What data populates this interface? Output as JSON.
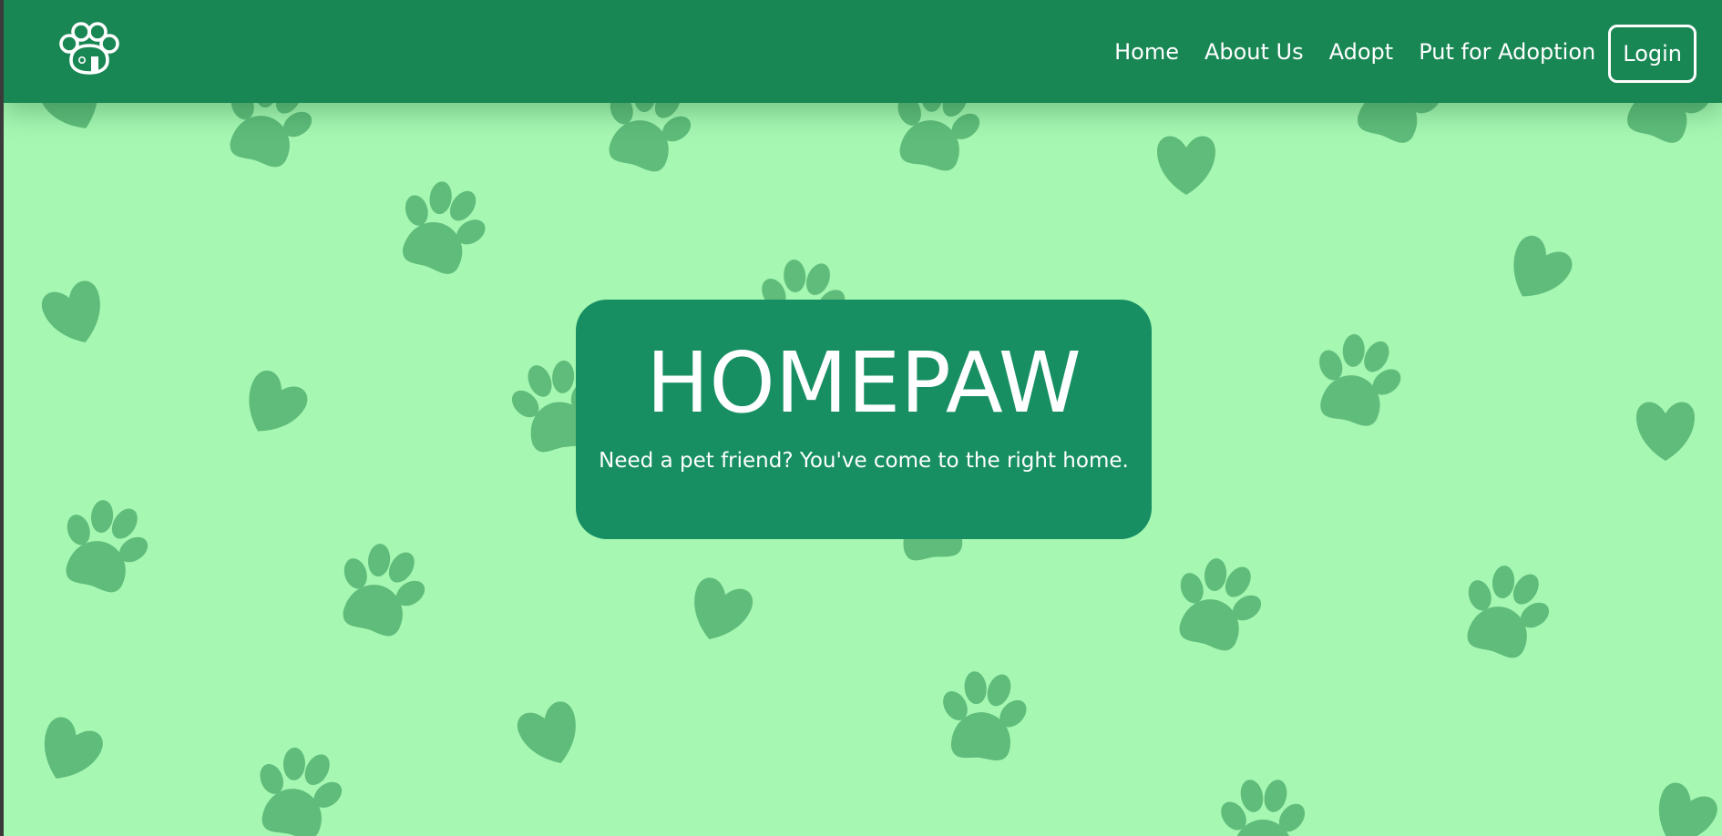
{
  "brand": {
    "logo_icon": "paw-house-logo"
  },
  "nav": {
    "items": [
      {
        "label": "Home"
      },
      {
        "label": "About Us"
      },
      {
        "label": "Adopt"
      },
      {
        "label": "Put for Adoption"
      }
    ],
    "login_label": "Login"
  },
  "hero": {
    "title": "HOMEPAW",
    "subtitle": "Need a pet friend? You've come to the right home."
  },
  "background": {
    "pattern": "paw-prints-and-hearts",
    "icons": [
      "paw-print-icon",
      "heart-icon"
    ]
  },
  "colors": {
    "navbar": "#198754",
    "hero_box": "#178f63",
    "background": "#a6f7b2",
    "pattern": "#5bb978",
    "text": "#ffffff"
  }
}
